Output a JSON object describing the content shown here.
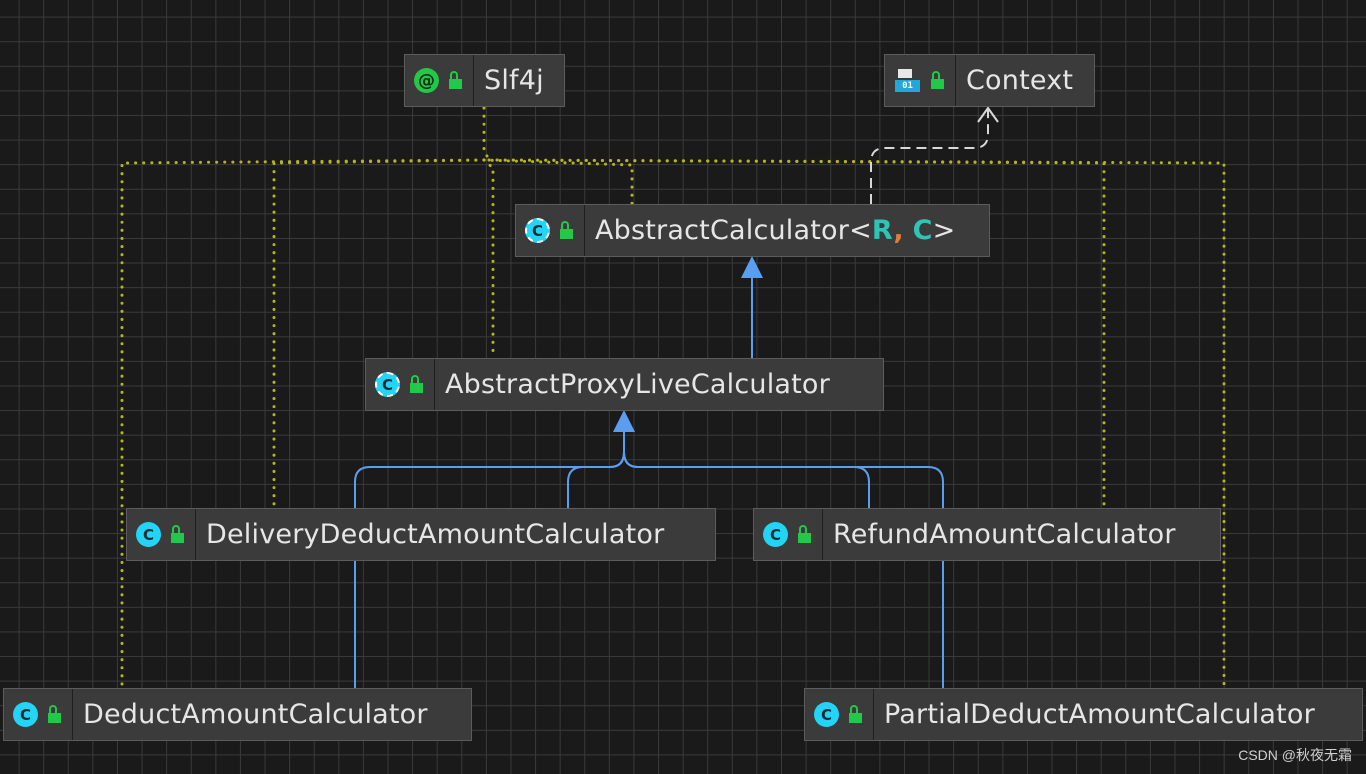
{
  "diagram": {
    "nodes": {
      "slf4j": {
        "name": "Slf4j",
        "kind": "annotation"
      },
      "context": {
        "name": "Context",
        "kind": "enum",
        "icon_text": "01"
      },
      "abstract_calculator": {
        "name": "AbstractCalculator",
        "open": "<",
        "param1": "R",
        "sep": ",",
        "param2": "C",
        "close": ">",
        "kind": "abstract-class"
      },
      "abstract_proxy": {
        "name": "AbstractProxyLiveCalculator",
        "kind": "abstract-class"
      },
      "delivery": {
        "name": "DeliveryDeductAmountCalculator",
        "kind": "class"
      },
      "refund": {
        "name": "RefundAmountCalculator",
        "kind": "class"
      },
      "deduct": {
        "name": "DeductAmountCalculator",
        "kind": "class"
      },
      "partial": {
        "name": "PartialDeductAmountCalculator",
        "kind": "class"
      }
    },
    "icon_letters": {
      "class": "C",
      "annotation": "@"
    },
    "colors": {
      "background": "#1a1a1a",
      "grid": "#3a3a3a",
      "node_fill": "#3b3b3b",
      "extends_edge": "#5b9ef0",
      "annotation_edge": "#b5b520",
      "implements_edge": "#d8d8d8",
      "type_param_r": "#2ec4b6",
      "type_param_c": "#2ec4b6",
      "type_param_sep": "#e07b3a"
    }
  },
  "watermark": "CSDN @秋夜无霜"
}
